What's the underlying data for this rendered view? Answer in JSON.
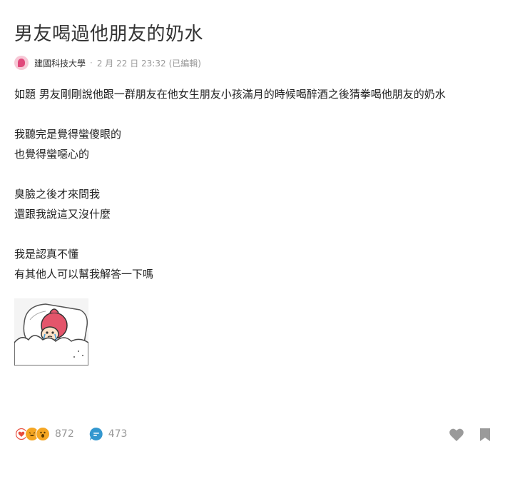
{
  "post": {
    "title": "男友喝過他朋友的奶水",
    "author_school": "建國科技大學",
    "separator": "·",
    "timestamp": "2 月 22 日 23:32",
    "edited_label": "(已編輯)"
  },
  "content": {
    "lines": [
      "如題 男友剛剛說他跟一群朋友在他女生朋友小孩滿月的時候喝醉酒之後猜拳喝他朋友的奶水",
      "",
      "我聽完是覺得蠻傻眼的",
      "也覺得蠻噁心的",
      "",
      "臭臉之後才來問我",
      "還跟我說這又沒什麼",
      "",
      "我是認真不懂",
      "有其他人可以幫我解答一下嗎"
    ]
  },
  "footer": {
    "reaction_count": "872",
    "comment_count": "473",
    "reactions": [
      "heart-reaction",
      "laugh-reaction",
      "wow-reaction"
    ],
    "colors": {
      "heart": "#e74c3c",
      "laugh": "#f5a623",
      "wow": "#f5a623",
      "comment": "#3397cf",
      "action_icon": "#999999"
    }
  }
}
